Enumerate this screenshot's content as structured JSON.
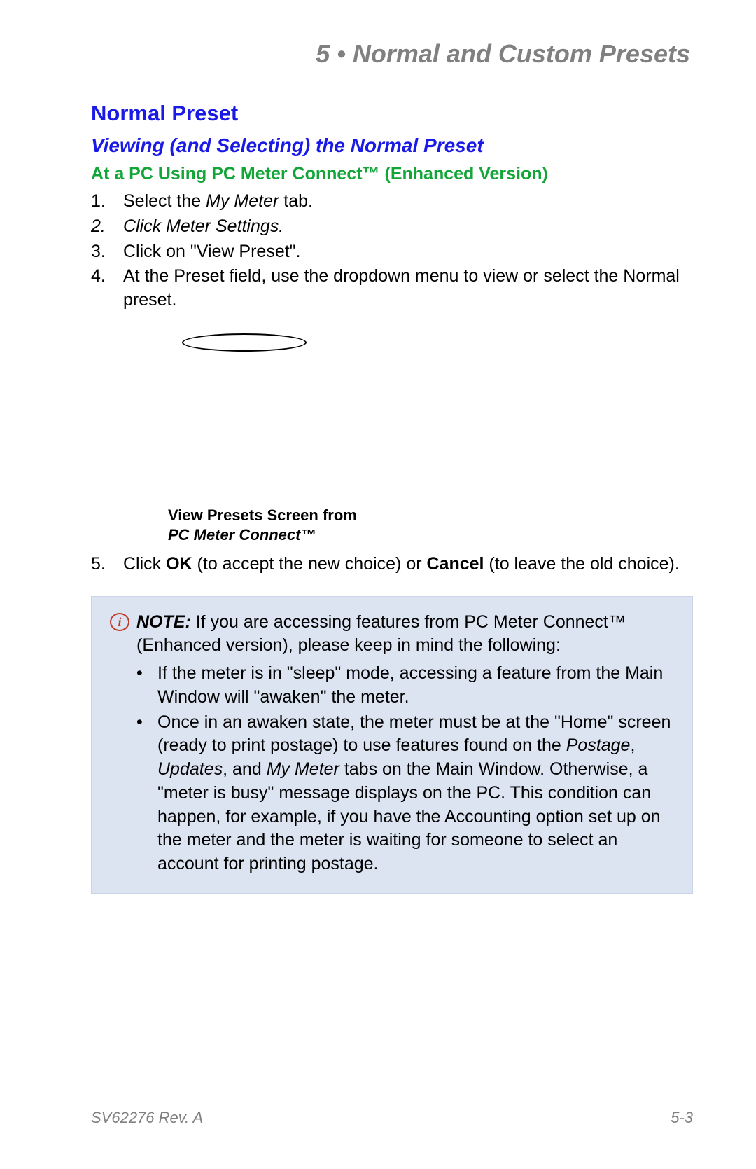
{
  "chapter": {
    "number": "5",
    "bullet": "•",
    "title": "Normal and Custom Presets"
  },
  "section": "Normal Preset",
  "subsection": "Viewing (and Selecting) the Normal Preset",
  "subsub": "At a PC Using PC Meter Connect™ (Enhanced Version)",
  "steps": {
    "s1": {
      "n": "1.",
      "pre": "Select the ",
      "it": "My Meter",
      "post": " tab."
    },
    "s2": {
      "n": "2.",
      "pre": "Click ",
      "it": "Meter Settings",
      "post": "."
    },
    "s3": {
      "n": "3.",
      "t": "Click on \"View Preset\"."
    },
    "s4": {
      "n": "4.",
      "t": "At the Preset field, use the dropdown menu to view or select the Normal preset."
    },
    "s5": {
      "n": "5.",
      "pre": "Click ",
      "b1": "OK",
      "mid": " (to accept the new choice) or ",
      "b2": "Cancel",
      "post": " (to leave the old choice)."
    }
  },
  "figure": {
    "caption_l1": "View Presets Screen from",
    "caption_l2": "PC Meter Connect™"
  },
  "note": {
    "icon": "i",
    "label": "NOTE:",
    "intro": " If you are accessing features from PC Meter Connect™ (Enhanced version), please keep in mind the following:",
    "b1": "If the meter is in \"sleep\" mode, accessing a feature from the Main Window will \"awaken\" the meter.",
    "b2_pre": "Once in an awaken state, the meter must be at the \"Home\" screen (ready to print postage) to use features found on the ",
    "b2_it1": "Postage",
    "b2_c1": ", ",
    "b2_it2": "Updates",
    "b2_c2": ", and ",
    "b2_it3": "My Meter",
    "b2_post": " tabs on the Main Window. Otherwise, a \"meter is busy\" message displays on the PC. This condition can happen, for example, if you have the Accounting option set up on the meter and the meter is waiting for someone to select an account for printing postage."
  },
  "footer": {
    "docid": "SV62276 Rev. A",
    "pagenum": "5-3"
  }
}
